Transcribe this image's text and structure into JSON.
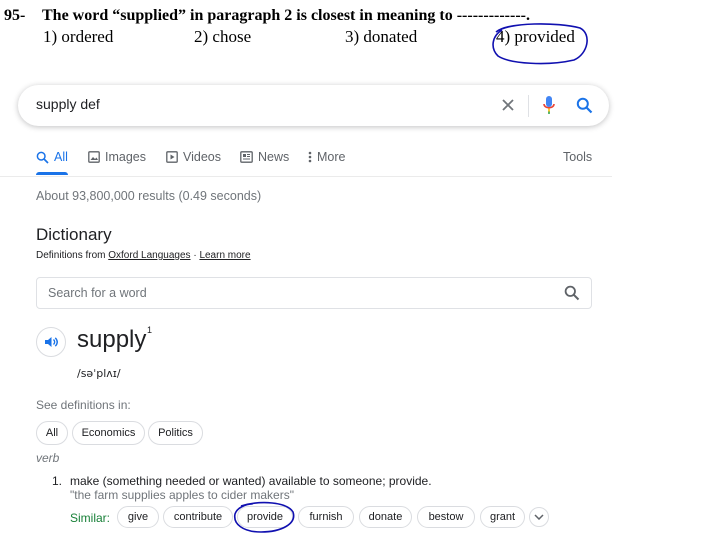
{
  "question": {
    "number": "95-",
    "text": "The word “supplied” in paragraph 2 is closest in meaning to -------------.",
    "options": [
      "1) ordered",
      "2) chose",
      "3) donated",
      "4) provided"
    ],
    "circled_option_index": 3
  },
  "search": {
    "query": "supply def",
    "clear_icon": "close-icon",
    "voice_icon": "microphone-icon",
    "search_icon": "search-icon"
  },
  "tabs": {
    "items": [
      {
        "label": "All",
        "icon": "search-icon",
        "active": true
      },
      {
        "label": "Images",
        "icon": "image-icon",
        "active": false
      },
      {
        "label": "Videos",
        "icon": "play-icon",
        "active": false
      },
      {
        "label": "News",
        "icon": "news-icon",
        "active": false
      },
      {
        "label": "More",
        "icon": "more-vert-icon",
        "active": false
      }
    ],
    "tools_label": "Tools"
  },
  "results": {
    "count_text": "About 93,800,000 results (0.49 seconds)"
  },
  "dictionary": {
    "title": "Dictionary",
    "source_prefix": "Definitions from",
    "source_link": "Oxford Languages",
    "separator": "·",
    "learn_more": "Learn more",
    "word_search_placeholder": "Search for a word",
    "headword": "supply",
    "headword_sup": "1",
    "phonetic": "/səˈplʌɪ/",
    "see_definitions_label": "See definitions in:",
    "definition_chips": [
      "All",
      "Economics",
      "Politics"
    ],
    "part_of_speech": "verb",
    "definitions": [
      {
        "number": "1.",
        "text": "make (something needed or wanted) available to someone; provide.",
        "example": "\"the farm supplies apples to cider makers\""
      }
    ],
    "similar_label": "Similar:",
    "similar_words": [
      "give",
      "contribute",
      "provide",
      "furnish",
      "donate",
      "bestow",
      "grant"
    ],
    "circled_similar_index": 2
  },
  "colors": {
    "accent_blue": "#1a73e8",
    "similar_green": "#188038",
    "muted_gray": "#70757a",
    "ink_circle": "#1010b0",
    "mic_red": "#ea4335",
    "mic_yellow": "#fbbc04"
  }
}
